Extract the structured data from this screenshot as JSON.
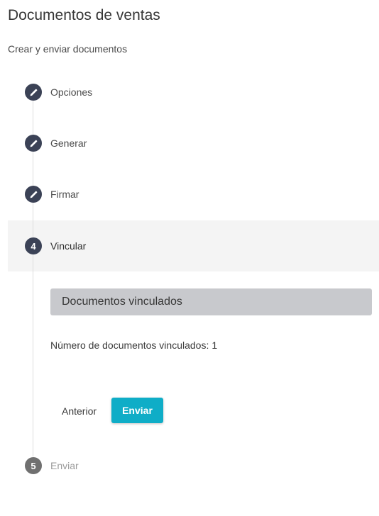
{
  "header": {
    "title": "Documentos de ventas",
    "subtitle": "Crear y enviar documentos"
  },
  "steps": [
    {
      "label": "Opciones",
      "status": "completed",
      "icon": "pencil-icon"
    },
    {
      "label": "Generar",
      "status": "completed",
      "icon": "pencil-icon"
    },
    {
      "label": "Firmar",
      "status": "completed",
      "icon": "pencil-icon"
    },
    {
      "number": "4",
      "label": "Vincular",
      "status": "active"
    },
    {
      "number": "5",
      "label": "Enviar",
      "status": "disabled"
    }
  ],
  "panel": {
    "title": "Documentos vinculados",
    "count_label": "Número de documentos vinculados:",
    "count_value": "1"
  },
  "actions": {
    "previous_label": "Anterior",
    "send_label": "Enviar"
  },
  "colors": {
    "step_circle": "#3b4256",
    "step_disabled": "#707070",
    "accent": "#0fadc7",
    "panel_header": "#c8c9cd"
  }
}
